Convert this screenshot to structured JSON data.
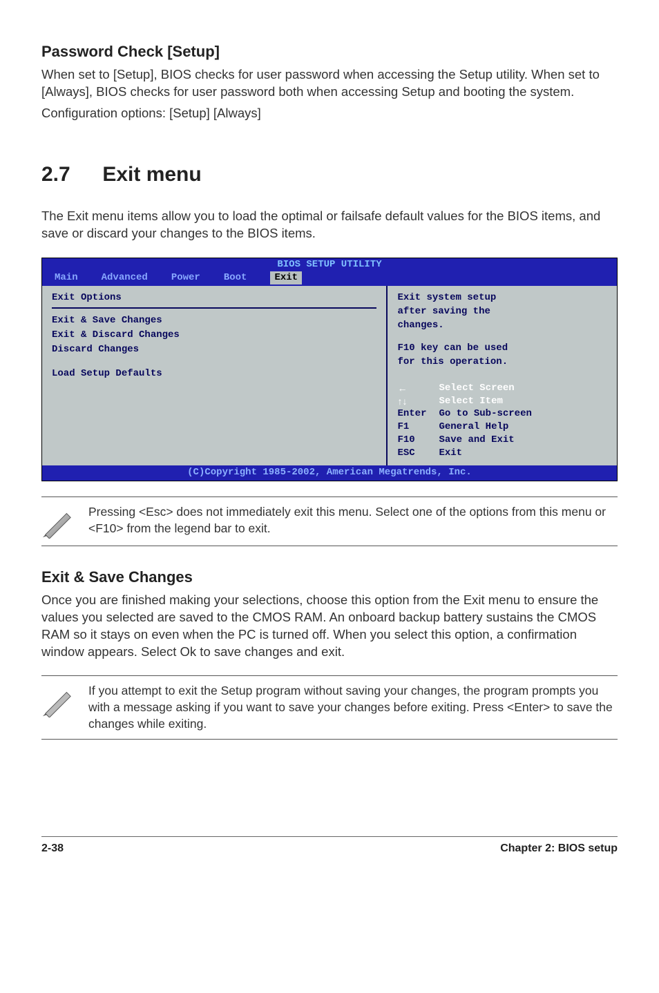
{
  "headings": {
    "password_check": "Password Check [Setup]",
    "section_num": "2.7",
    "section_title": "Exit menu",
    "exit_save": "Exit & Save Changes"
  },
  "paragraphs": {
    "password_check_body": "When set to [Setup], BIOS checks for user password when accessing the Setup utility. When set to [Always], BIOS checks for user password both when accessing Setup and booting the system.",
    "password_check_config": "Configuration options: [Setup] [Always]",
    "exit_intro": "The Exit menu items allow you to load the optimal or failsafe default values for the BIOS items, and save or discard your changes to the BIOS items.",
    "exit_save_body": "Once you are finished making your selections, choose this option from the Exit menu to ensure the values you selected are saved to the CMOS RAM. An onboard backup battery sustains the CMOS RAM so it stays on even when the PC is turned off. When you select this option, a confirmation window appears. Select Ok to save changes and exit."
  },
  "notes": {
    "note1": "Pressing <Esc> does not immediately exit this menu. Select one of the options from this menu or <F10> from the legend bar to exit.",
    "note2": " If you attempt to exit the Setup program without saving your changes, the program prompts you with a message asking if you want to save your changes before exiting. Press <Enter>  to save the  changes while exiting."
  },
  "bios": {
    "title": "BIOS SETUP UTILITY",
    "tabs": {
      "main": "Main",
      "advanced": "Advanced",
      "power": "Power",
      "boot": "Boot",
      "exit": "Exit"
    },
    "left": {
      "group": "Exit Options",
      "items": [
        "Exit & Save Changes",
        "Exit & Discard Changes",
        "Discard Changes",
        "Load Setup Defaults"
      ]
    },
    "help": {
      "l1": "Exit system setup",
      "l2": "after saving the",
      "l3": "changes.",
      "l4": "F10 key can be used",
      "l5": "for this operation."
    },
    "keys": [
      {
        "k": "←",
        "v": "Select Screen"
      },
      {
        "k": "↑↓",
        "v": "Select Item"
      },
      {
        "k": "Enter",
        "v": "Go to Sub-screen"
      },
      {
        "k": "F1",
        "v": "General Help"
      },
      {
        "k": "F10",
        "v": "Save and Exit"
      },
      {
        "k": "ESC",
        "v": "Exit"
      }
    ],
    "footer": "(C)Copyright 1985-2002, American Megatrends, Inc."
  },
  "footer": {
    "page": "2-38",
    "chapter": "Chapter 2: BIOS setup"
  }
}
